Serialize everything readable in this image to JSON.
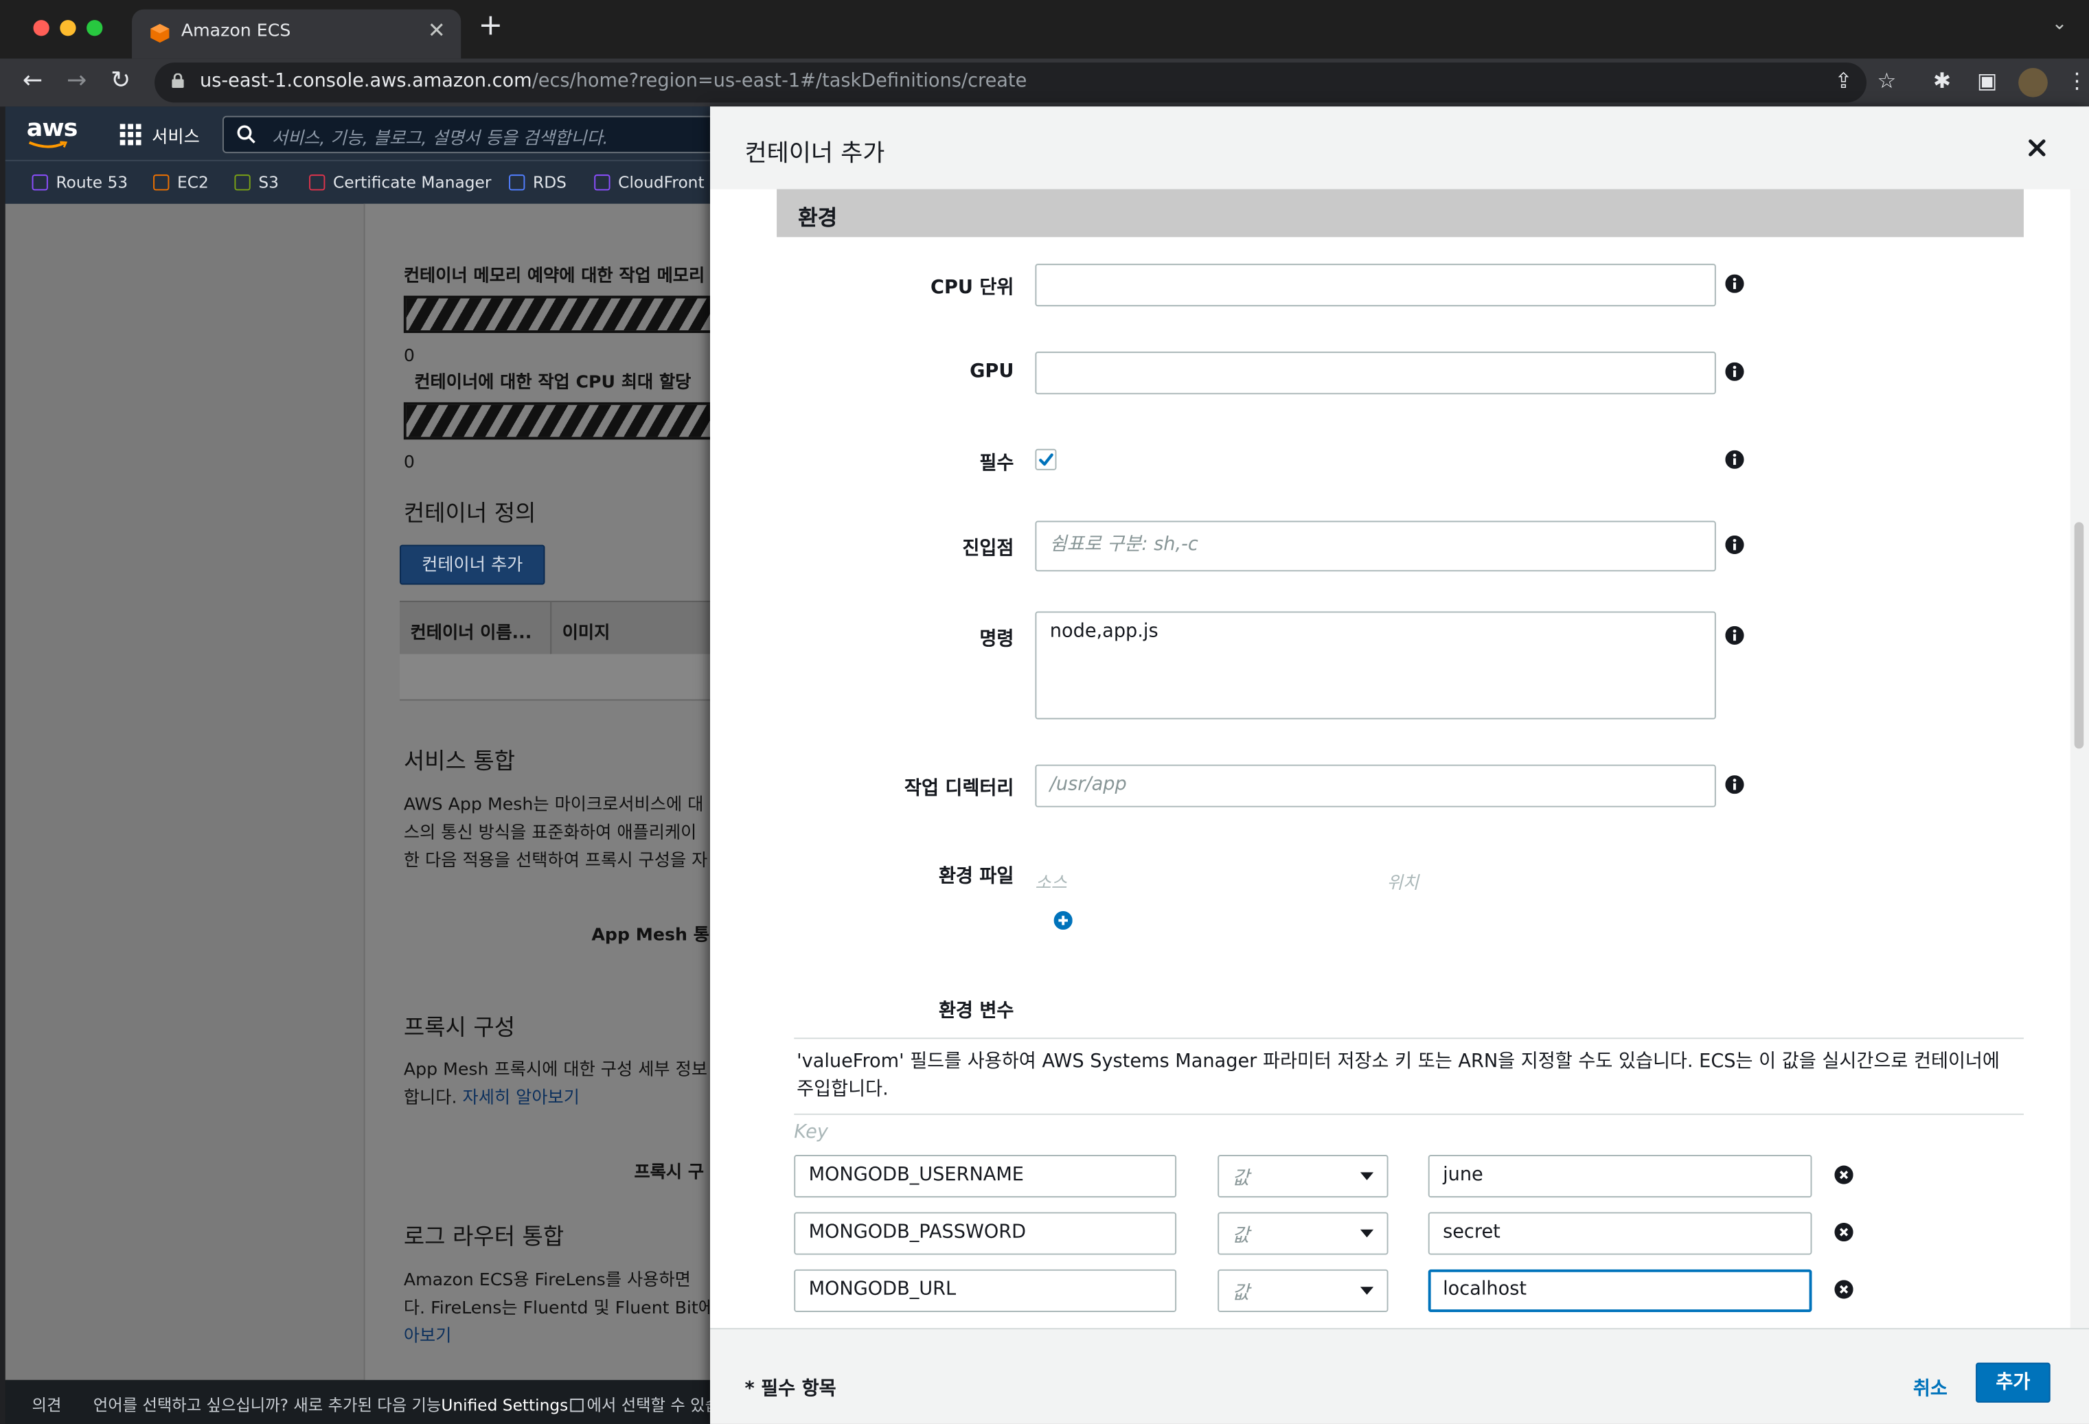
{
  "browser": {
    "tab_title": "Amazon ECS",
    "url_host": "us-east-1.console.aws.amazon.com",
    "url_path": "/ecs/home?region=us-east-1#/taskDefinitions/create"
  },
  "aws_nav": {
    "logo": "aws",
    "services_label": "서비스",
    "search_placeholder": "서비스, 기능, 블로그, 설명서 등을 검색합니다.",
    "favorites": [
      {
        "label": "Route 53",
        "color": "#8c4fff"
      },
      {
        "label": "EC2",
        "color": "#ed7100"
      },
      {
        "label": "S3",
        "color": "#7aa116"
      },
      {
        "label": "Certificate Manager",
        "color": "#dd344c"
      },
      {
        "label": "RDS",
        "color": "#527fff"
      },
      {
        "label": "CloudFront",
        "color": "#8c4fff"
      }
    ]
  },
  "background_page": {
    "memory_label": "컨테이너 메모리 예약에 대한 작업 메모리",
    "memory_value": "0",
    "cpu_label": "컨테이너에 대한 작업 CPU 최대 할당",
    "cpu_value": "0",
    "container_def_title": "컨테이너 정의",
    "add_container_button": "컨테이너 추가",
    "table_headers": [
      "컨테이너 이름...",
      "이미지"
    ],
    "service_integration_title": "서비스 통합",
    "service_integration_lines": [
      "AWS App Mesh는 마이크로서비스에 대",
      "스의 통신 방식을 표준화하여 애플리케이",
      "한 다음 적용을 선택하여 프록시 구성을 자"
    ],
    "app_mesh_label": "App Mesh 통",
    "proxy_title": "프록시 구성",
    "proxy_lines": [
      "App Mesh 프록시에 대한 구성 세부 정보",
      "합니다."
    ],
    "learn_more": "자세히 알아보기",
    "proxy_label": "프록시 구",
    "log_router_title": "로그 라우터 통합",
    "log_router_lines": [
      "Amazon ECS용 FireLens를 사용하면",
      "다. FireLens는 Fluentd 및 Fluent Bit에"
    ],
    "log_router_link": "아보기"
  },
  "footer": {
    "feedback": "의견",
    "language_prompt": "언어를 선택하고 싶으십니까? 새로 추가된 다음 기능",
    "unified_settings": "Unified Settings",
    "suffix": "에서 선택할 수 있습니"
  },
  "modal": {
    "title": "컨테이너 추가",
    "section_title": "환경",
    "fields": {
      "cpu_label": "CPU 단위",
      "cpu_value": "",
      "gpu_label": "GPU",
      "gpu_value": "",
      "essential_label": "필수",
      "essential_checked": true,
      "entrypoint_label": "진입점",
      "entrypoint_placeholder": "쉼표로 구분: sh,-c",
      "command_label": "명령",
      "command_value": "node,app.js",
      "workdir_label": "작업 디렉터리",
      "workdir_placeholder": "/usr/app",
      "envfile_label": "환경 파일",
      "envfile_source_header": "소스",
      "envfile_location_header": "위치",
      "envvars_label": "환경 변수"
    },
    "env_note": "'valueFrom' 필드를 사용하여 AWS Systems Manager 파라미터 저장소 키 또는 ARN을 지정할 수도 있습니다. ECS는 이 값을 실시간으로 컨테이너에 주입합니다.",
    "env_key_header": "Key",
    "env_vars": [
      {
        "key": "MONGODB_USERNAME",
        "type": "값",
        "value": "june"
      },
      {
        "key": "MONGODB_PASSWORD",
        "type": "값",
        "value": "secret"
      },
      {
        "key": "MONGODB_URL",
        "type": "값",
        "value": "localhost"
      }
    ],
    "required_note": "* 필수 항목",
    "cancel_label": "취소",
    "add_label": "추가"
  }
}
